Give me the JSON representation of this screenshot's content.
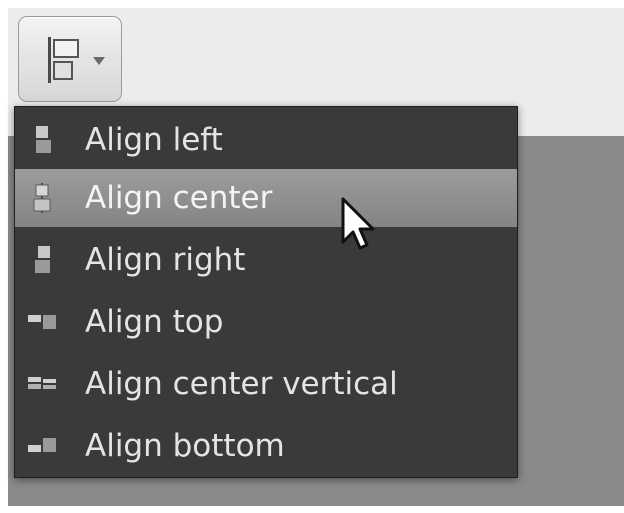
{
  "toolbar": {
    "align_button": {
      "icon": "align-left-icon",
      "dropdown_icon": "chevron-down-icon"
    }
  },
  "menu": {
    "items": [
      {
        "label": "Align left",
        "icon": "align-left-icon",
        "highlighted": false
      },
      {
        "label": "Align center",
        "icon": "align-center-icon",
        "highlighted": true
      },
      {
        "label": "Align right",
        "icon": "align-right-icon",
        "highlighted": false
      },
      {
        "label": "Align top",
        "icon": "align-top-icon",
        "highlighted": false
      },
      {
        "label": "Align center vertical",
        "icon": "align-center-vertical-icon",
        "highlighted": false
      },
      {
        "label": "Align bottom",
        "icon": "align-bottom-icon",
        "highlighted": false
      }
    ]
  },
  "colors": {
    "menu_background": "#3a3a3a",
    "menu_highlight": "#8f8f8f",
    "menu_text": "#e4e4e4",
    "toolbar_background": "#ececec",
    "workarea_background": "#8a8a8a"
  },
  "cursor": {
    "icon": "mouse-pointer-icon"
  }
}
